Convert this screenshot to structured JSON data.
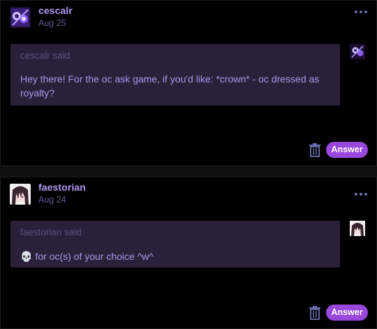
{
  "posts": [
    {
      "username": "cescalr",
      "date": "Aug 25",
      "asker_said": "cescalr said",
      "question": "Hey there! For the oc ask game, if you'd like: *crown* - oc dressed as royalty?",
      "answer_label": "Answer",
      "avatar_icon": "purple-abstract-avatar-icon"
    },
    {
      "username": "faestorian",
      "date": "Aug 24",
      "asker_said": "faestorian said",
      "emoji": "💀",
      "question": "for oc(s) of your choice ^w^",
      "answer_label": "Answer",
      "avatar_icon": "anime-character-avatar-icon"
    }
  ],
  "colors": {
    "background": "#000000",
    "bubble": "#2b2039",
    "username": "#b399f5",
    "question_text": "#a896ee",
    "answer_button": "#9a47dd"
  }
}
